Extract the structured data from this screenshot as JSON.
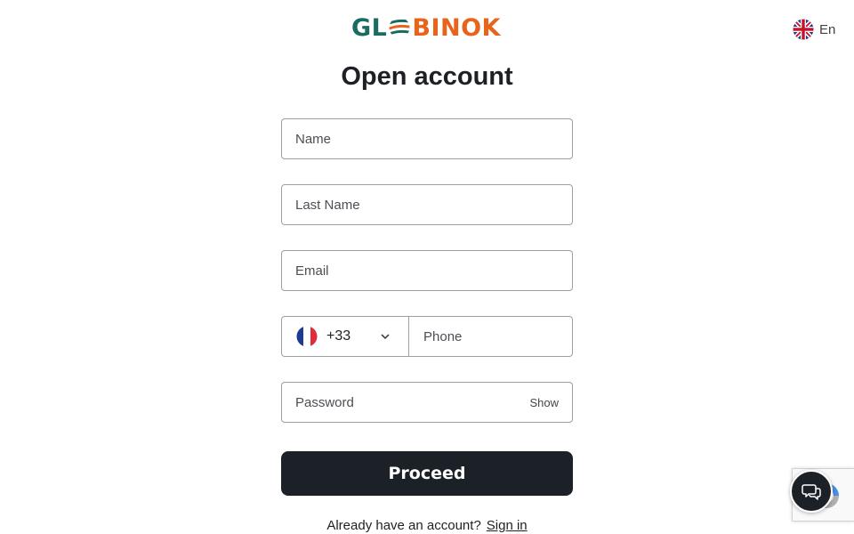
{
  "header": {
    "logo": {
      "part_a": "GL",
      "part_b": "BINOK",
      "colors": {
        "primary": "#1a6b60",
        "accent": "#e8641b"
      }
    },
    "language": {
      "label": "En",
      "flag_icon": "uk-flag-icon"
    }
  },
  "form": {
    "title": "Open account",
    "name": {
      "placeholder": "Name",
      "value": ""
    },
    "last_name": {
      "placeholder": "Last Name",
      "value": ""
    },
    "email": {
      "placeholder": "Email",
      "value": ""
    },
    "phone": {
      "country_flag": "france-flag-icon",
      "country_code": "+33",
      "placeholder": "Phone",
      "value": ""
    },
    "password": {
      "placeholder": "Password",
      "value": "",
      "toggle_label": "Show"
    },
    "submit_label": "Proceed"
  },
  "footer": {
    "question": "Already have an account?",
    "signin_label": "Sign in"
  },
  "widgets": {
    "chat_icon": "chat-bubbles-icon",
    "recaptcha_icon": "recaptcha-icon"
  },
  "colors": {
    "button_bg": "#1b2126",
    "border": "#9aa0a6"
  }
}
